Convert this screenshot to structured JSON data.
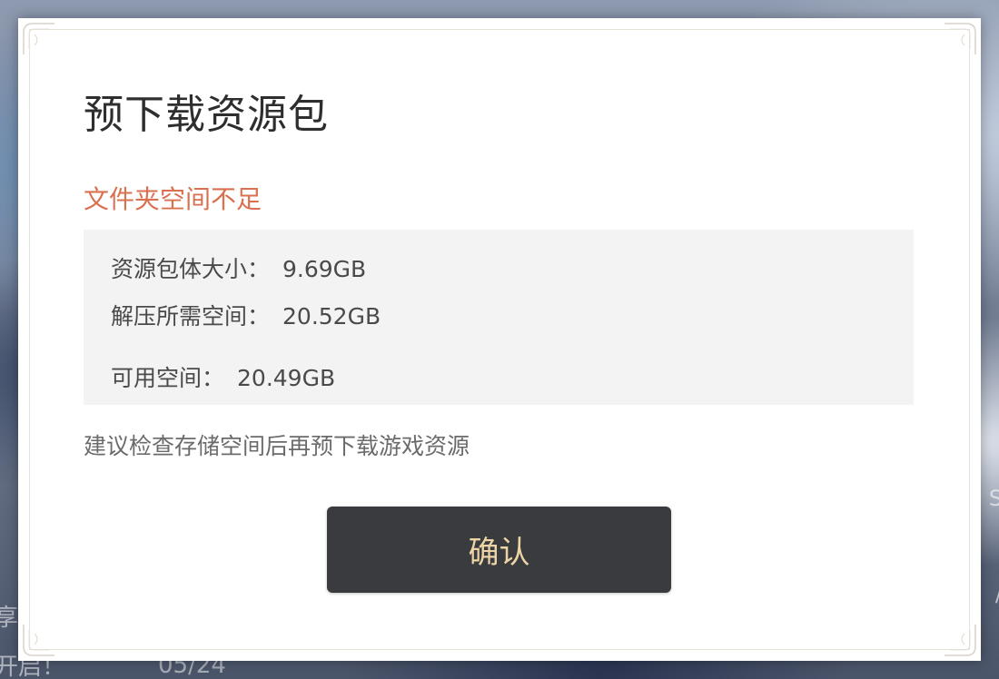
{
  "background": {
    "left_text_1": "享",
    "left_text_2": "开启！",
    "date": "05/24",
    "right_text_1": "S",
    "right_text_2": "/"
  },
  "dialog": {
    "title": "预下载资源包",
    "warning": "文件夹空间不足",
    "info": {
      "package_size_label": "资源包体大小：",
      "package_size_value": "9.69GB",
      "unpack_space_label": "解压所需空间：",
      "unpack_space_value": "20.52GB",
      "available_space_label": "可用空间：",
      "available_space_value": "20.49GB"
    },
    "hint": "建议检查存储空间后再预下载游戏资源",
    "confirm_label": "确认"
  },
  "colors": {
    "warning": "#d9704f",
    "button_bg": "#3a3b3f",
    "button_text": "#ecd4a6",
    "panel_bg": "#f3f3f4"
  }
}
